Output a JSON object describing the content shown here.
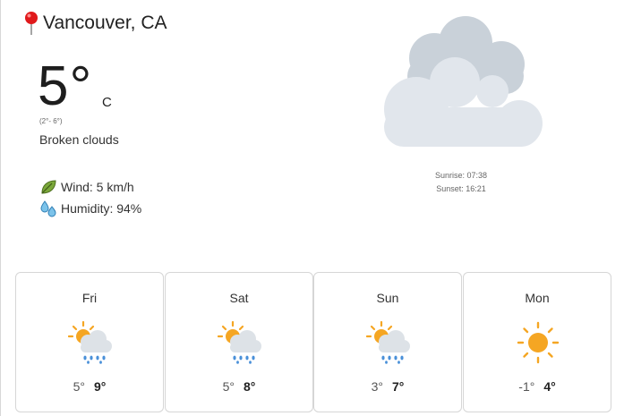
{
  "location": {
    "name": "Vancouver, CA",
    "icon": "map-pin-icon"
  },
  "current": {
    "temp": "5°",
    "unit": "C",
    "range": "(2°- 6°)",
    "description": "Broken clouds",
    "wind_label": "Wind: 5 km/h",
    "humidity_label": "Humidity: 94%",
    "sunrise": "Sunrise: 07:38",
    "sunset": "Sunset: 16:21",
    "icon": "broken-clouds-icon"
  },
  "forecast": [
    {
      "day": "Fri",
      "low": "5°",
      "high": "9°",
      "icon": "sun-rain-icon"
    },
    {
      "day": "Sat",
      "low": "5°",
      "high": "8°",
      "icon": "sun-rain-icon"
    },
    {
      "day": "Sun",
      "low": "3°",
      "high": "7°",
      "icon": "sun-rain-icon"
    },
    {
      "day": "Mon",
      "low": "-1°",
      "high": "4°",
      "icon": "sun-icon"
    }
  ],
  "colors": {
    "cloud_back": "#c9d1d9",
    "cloud_front": "#e1e6ec",
    "sun": "#f5a623",
    "rain": "#4a90d9",
    "pin": "#e0191b"
  }
}
